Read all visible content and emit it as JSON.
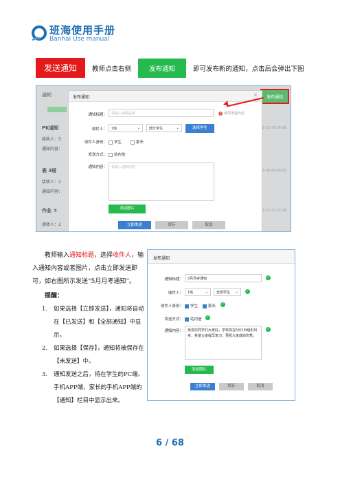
{
  "header": {
    "logo_cn": "班海使用手册",
    "logo_en": "Banhai Use manual",
    "brand_color": "#1f6fb4"
  },
  "intro": {
    "section_tag": "发送通知",
    "text1": "教师点击右侧",
    "publish_button": "发布通知",
    "text2": "即可发布新的通知，点击后会弹出下图"
  },
  "screenshot1": {
    "bg_header": "通知",
    "bg_publish_button": "发布通知",
    "bg_rows": [
      {
        "label": "PK通知",
        "time": "2021-03-15 17:34:06"
      },
      {
        "label": "接收人：5",
        "time": ""
      },
      {
        "label": "通知内容：",
        "time": ""
      },
      {
        "label": "表 3班",
        "time": "2021-03-08 09:44:01"
      },
      {
        "label": "接收人：1",
        "time": ""
      },
      {
        "label": "通知内容：",
        "time": ""
      },
      {
        "label": "作业 ①",
        "time": "2021-03-13 12:22:38"
      },
      {
        "label": "接收人：2",
        "time": ""
      }
    ],
    "dialog": {
      "title": "发布通知",
      "close": "×",
      "title_label": "通知标题：",
      "title_placeholder": "请输入标题名称",
      "title_hint": "该项不能为空",
      "receiver_label": "收件人：",
      "class_value": "1班",
      "scope_value": "部分学生",
      "choose_students": "选择学生",
      "receiver_identity_label": "收件人身份：",
      "identity_student": "学生",
      "identity_parent": "家长",
      "send_method_label": "发送方式：",
      "send_method_option": "站内信",
      "content_label": "通知内容：",
      "content_placeholder": "请输入通知内容",
      "add_image": "添加图片",
      "send_now": "立即发送",
      "save": "保存",
      "cancel": "取消"
    }
  },
  "body": {
    "para1_a": "教师输入",
    "para1_red1": "通知标题",
    "para1_b": "，选择",
    "para1_red2": "收件人",
    "para1_c": "，输入通知内容或者图片，点击立即发送即可，如右图所示发送“5月月考通知”。",
    "tips_title": "提醒：",
    "tips": [
      {
        "num": "1.",
        "text": "如果选择【立即发送】，通知将自动在【已发送】和【全部通知】中显示。"
      },
      {
        "num": "2.",
        "text": "如果选择【保存】，通知将被保存在【未发送】中。"
      },
      {
        "num": "3.",
        "text": "通知发送之后，将在学生的PC端、手机APP端，家长的手机APP端的【通知】栏目中显示出来。"
      }
    ]
  },
  "screenshot2": {
    "title": "发布通知",
    "title_label": "通知标题：",
    "title_value": "5月月考通知",
    "receiver_label": "收件人：",
    "class_value": "1班",
    "scope_value": "全部学生",
    "identity_label": "收件人身份：",
    "identity_student": "学生",
    "identity_parent": "家长",
    "send_method_label": "发送方式：",
    "send_method_option": "站内信",
    "content_label": "通知内容：",
    "content_value": "亲爱的同学们大家好，学校将在5月3日组织月考，希望大家提早复习，预祝大家成绩优秀。",
    "add_image": "添加图片",
    "send_now": "立即发送",
    "save": "保存",
    "cancel": "取消"
  },
  "footer": {
    "page": "6 / 68"
  }
}
